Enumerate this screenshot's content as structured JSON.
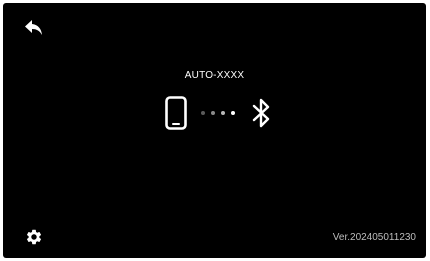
{
  "colors": {
    "background": "#000000",
    "foreground": "#ffffff",
    "version_text": "#bdbdbd",
    "dots": [
      "#5a5a5a",
      "#8a8a8a",
      "#b8b8b8",
      "#ffffff"
    ]
  },
  "header": {
    "back_icon": "back-arrow-icon"
  },
  "pairing": {
    "device_name": "AUTO-XXXX",
    "source_icon": "smartphone-icon",
    "target_icon": "bluetooth-icon",
    "progress_dots": 4
  },
  "footer": {
    "settings_icon": "gear-icon",
    "version": "Ver.202405011230"
  }
}
